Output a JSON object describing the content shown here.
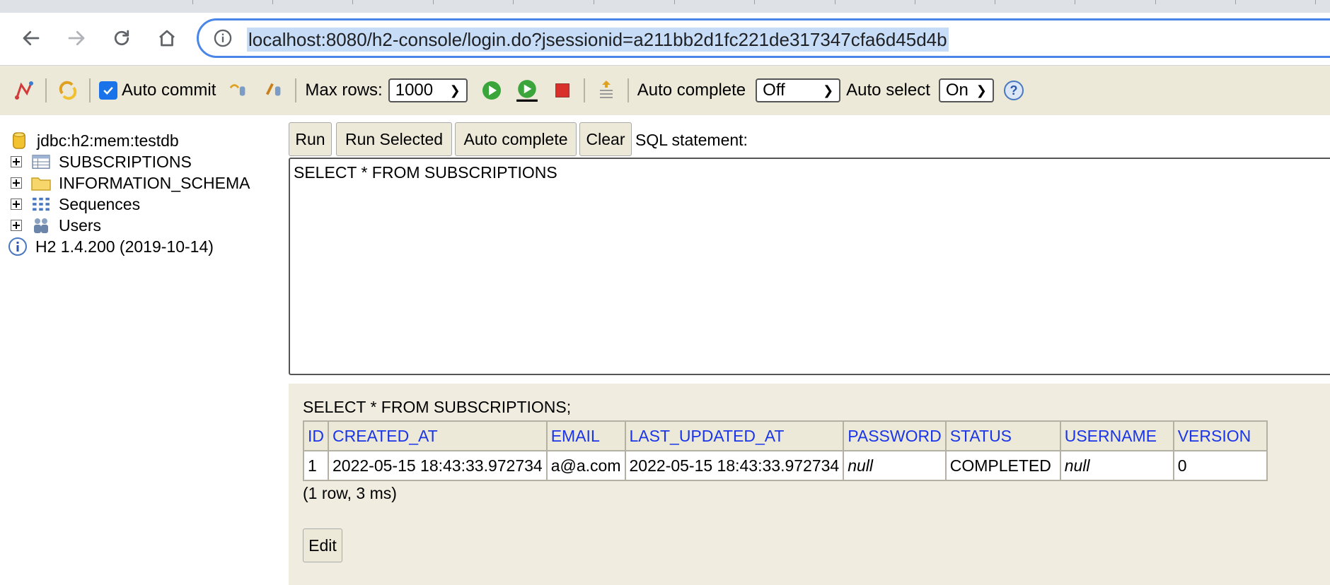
{
  "browser": {
    "url": "localhost:8080/h2-console/login.do?jsessionid=a211bb2d1fc221de317347cfa6d45d4b"
  },
  "toolbar": {
    "auto_commit_label": "Auto commit",
    "auto_commit_checked": true,
    "max_rows_label": "Max rows:",
    "max_rows_value": "1000",
    "auto_complete_label": "Auto complete",
    "auto_complete_value": "Off",
    "auto_select_label": "Auto select",
    "auto_select_value": "On",
    "help_glyph": "?"
  },
  "tree": {
    "connection": "jdbc:h2:mem:testdb",
    "items": [
      {
        "label": "SUBSCRIPTIONS",
        "icon": "table-icon"
      },
      {
        "label": "INFORMATION_SCHEMA",
        "icon": "folder-icon"
      },
      {
        "label": "Sequences",
        "icon": "sequences-icon"
      },
      {
        "label": "Users",
        "icon": "users-icon"
      }
    ],
    "version": "H2 1.4.200 (2019-10-14)"
  },
  "query": {
    "buttons": {
      "run": "Run",
      "run_selected": "Run Selected",
      "auto_complete": "Auto complete",
      "clear": "Clear"
    },
    "sql_label": "SQL statement:",
    "sql_text": "SELECT * FROM SUBSCRIPTIONS"
  },
  "results": {
    "statement": "SELECT * FROM SUBSCRIPTIONS;",
    "columns": [
      "ID",
      "CREATED_AT",
      "EMAIL",
      "LAST_UPDATED_AT",
      "PASSWORD",
      "STATUS",
      "USERNAME",
      "VERSION"
    ],
    "rows": [
      [
        "1",
        "2022-05-15 18:43:33.972734",
        "a@a.com",
        "2022-05-15 18:43:33.972734",
        "null",
        "COMPLETED",
        "null",
        "0"
      ]
    ],
    "meta": "(1 row, 3 ms)",
    "edit_label": "Edit"
  },
  "colors": {
    "chrome_bg": "#ece9d8",
    "result_bg": "#f0ede0",
    "link_blue": "#1a35e8",
    "omnibox_border": "#4a86e8"
  }
}
